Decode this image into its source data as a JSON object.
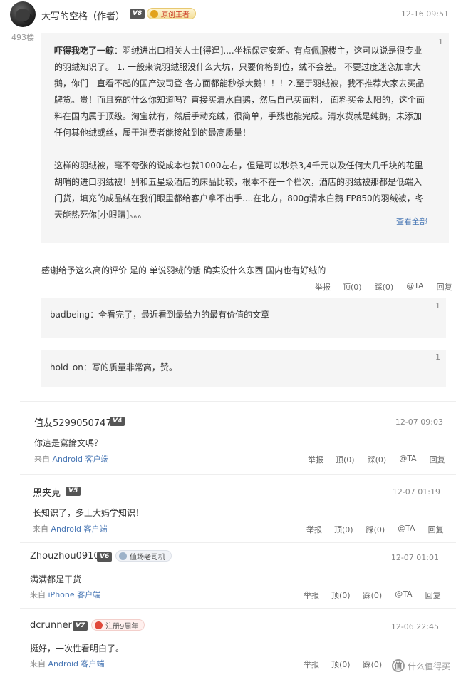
{
  "main_comment": {
    "username": "大写的空格（作者）",
    "level": "V8",
    "badge": "原创王者",
    "floor": "493楼",
    "time": "12-16 09:51",
    "quote": {
      "number": "1",
      "author": "吓得我吃了一鲸",
      "para1": "：羽绒进出口相关人士[得逞]....坐标保定安新。有点佩服楼主，这可以说是很专业的羽绒知识了。 1. 一般来说羽绒服没什么大坑，只要价格到位，绒不会差。 不要过度迷恋加拿大鹅，你们一直看不起的国产波司登 各方面都能秒杀大鹅！！！2.至于羽绒被，我不推荐大家去买品牌货。贵！而且充的什么你知道吗？直接买清水白鹅，然后自己买面料， 面料买金太阳的，这个面料在国内属于顶级。淘宝就有，然后手动充绒，很简单，手残也能完成。清水货就是纯鹅，未添加任何其他绒或丝，属于消费者能接触到的最高质量！",
      "para2": "这样的羽绒被，毫不夸张的说成本也就1000左右，但是可以秒杀3,4千元以及任何大几千块的花里胡哨的进口羽绒被！别和五星级酒店的床品比较，根本不在一个档次，酒店的羽绒被那都是低端入门货，填充的成品绒在我们眼里都给客户拿不出手....在北方，800g清水白鹅 FP850的羽绒被，冬天能热死你[小眼睛]。。。",
      "view_all": "查看全部"
    },
    "reply": "感谢给予这么高的评价 是的 单说羽绒的话 确实没什么东西 国内也有好绒的",
    "actions": [
      "举报",
      "顶(0)",
      "踩(0)",
      "@TA",
      "回复"
    ]
  },
  "sub_replies": [
    {
      "number": "1",
      "author": "badbeing",
      "text": "：全看完了，最近看到最给力的最有价值的文章"
    },
    {
      "number": "1",
      "author": "hold_on",
      "text": "：写的质量非常高，赞。"
    }
  ],
  "comments": [
    {
      "username": "值友5299050747",
      "level": "V4",
      "badge": "",
      "time": "12-07 09:03",
      "text": "你這是寫論文嗎？",
      "source_prefix": "来自",
      "source": "Android 客户端",
      "actions": [
        "举报",
        "顶(0)",
        "踩(0)",
        "@TA",
        "回复"
      ]
    },
    {
      "username": "黑夹克",
      "level": "V5",
      "badge": "",
      "time": "12-07 01:19",
      "text": "长知识了，多上大妈学知识！",
      "source_prefix": "来自",
      "source": "Android 客户端",
      "actions": [
        "举报",
        "顶(0)",
        "踩(0)",
        "@TA",
        "回复"
      ]
    },
    {
      "username": "Zhouzhou0910",
      "level": "V6",
      "badge": "值场老司机",
      "time": "12-07 01:01",
      "text": "满满都是干货",
      "source_prefix": "来自",
      "source": "iPhone 客户端",
      "actions": [
        "举报",
        "顶(0)",
        "踩(0)",
        "@TA",
        "回复"
      ]
    },
    {
      "username": "dcrunner",
      "level": "V7",
      "badge": "注册9周年",
      "time": "12-06 22:45",
      "text": "挺好，一次性看明白了。",
      "source_prefix": "来自",
      "source": "Android 客户端",
      "actions": [
        "举报",
        "顶(0)",
        "踩(0)",
        "@TA",
        "回复"
      ]
    }
  ],
  "watermark": {
    "icon": "值",
    "text": "什么值得买"
  }
}
